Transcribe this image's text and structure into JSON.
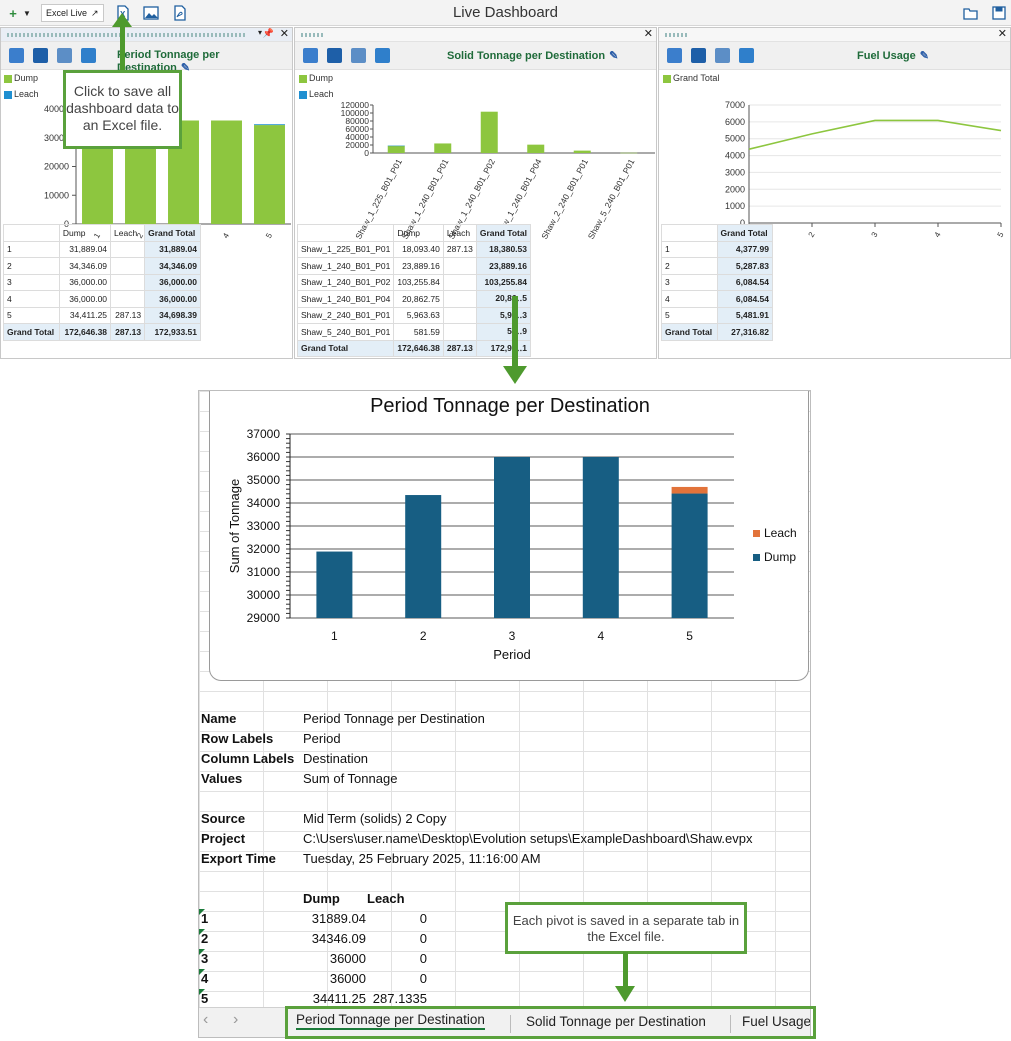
{
  "app": {
    "title": "Live Dashboard",
    "excel_live_label": "Excel Live",
    "add_icon": "plus-icon",
    "icons": [
      "excel-export-icon",
      "image-export-icon",
      "pdf-export-icon",
      "folder-open-icon",
      "save-icon"
    ]
  },
  "callouts": {
    "excel": "Click to save all dashboard data to an Excel file.",
    "tabs": "Each pivot is saved in a separate tab in the Excel file."
  },
  "panel1": {
    "title": "Period Tonnage per Destination",
    "legend": [
      "Dump",
      "Leach"
    ],
    "y_ticks": [
      "40000",
      "30000",
      "20000",
      "10000",
      "0"
    ],
    "x_ticks": [
      "1",
      "2",
      "3",
      "4",
      "5"
    ],
    "table": {
      "headers": [
        "",
        "Dump",
        "Leach",
        "Grand Total"
      ],
      "rows": [
        [
          "1",
          "31,889.04",
          "",
          "31,889.04"
        ],
        [
          "2",
          "34,346.09",
          "",
          "34,346.09"
        ],
        [
          "3",
          "36,000.00",
          "",
          "36,000.00"
        ],
        [
          "4",
          "36,000.00",
          "",
          "36,000.00"
        ],
        [
          "5",
          "34,411.25",
          "287.13",
          "34,698.39"
        ],
        [
          "Grand Total",
          "172,646.38",
          "287.13",
          "172,933.51"
        ]
      ]
    }
  },
  "panel2": {
    "title": "Solid Tonnage per Destination",
    "legend": [
      "Dump",
      "Leach"
    ],
    "y_ticks": [
      "120000",
      "100000",
      "80000",
      "60000",
      "40000",
      "20000",
      "0"
    ],
    "x_ticks": [
      "Shaw_1_225_B01_P01",
      "Shaw_1_240_B01_P01",
      "Shaw_1_240_B01_P02",
      "Shaw_1_240_B01_P04",
      "Shaw_2_240_B01_P01",
      "Shaw_5_240_B01_P01"
    ],
    "table": {
      "headers": [
        "",
        "Dump",
        "Leach",
        "Grand Total"
      ],
      "rows": [
        [
          "Shaw_1_225_B01_P01",
          "18,093.40",
          "287.13",
          "18,380.53"
        ],
        [
          "Shaw_1_240_B01_P01",
          "23,889.16",
          "",
          "23,889.16"
        ],
        [
          "Shaw_1_240_B01_P02",
          "103,255.84",
          "",
          "103,255.84"
        ],
        [
          "Shaw_1_240_B01_P04",
          "20,862.75",
          "",
          "20,86‥5"
        ],
        [
          "Shaw_2_240_B01_P01",
          "5,963.63",
          "",
          "5,96‥3"
        ],
        [
          "Shaw_5_240_B01_P01",
          "581.59",
          "",
          "58‥9"
        ],
        [
          "Grand Total",
          "172,646.38",
          "287.13",
          "172,93‥1"
        ]
      ]
    }
  },
  "panel3": {
    "title": "Fuel Usage",
    "legend": [
      "Grand Total"
    ],
    "y_ticks": [
      "7000",
      "6000",
      "5000",
      "4000",
      "3000",
      "2000",
      "1000",
      "0"
    ],
    "x_ticks": [
      "1",
      "2",
      "3",
      "4",
      "5"
    ],
    "table": {
      "headers": [
        "",
        "Grand Total"
      ],
      "rows": [
        [
          "1",
          "4,377.99"
        ],
        [
          "2",
          "5,287.83"
        ],
        [
          "3",
          "6,084.54"
        ],
        [
          "4",
          "6,084.54"
        ],
        [
          "5",
          "5,481.91"
        ],
        [
          "Grand Total",
          "27,316.82"
        ]
      ]
    }
  },
  "chart_data": [
    {
      "type": "bar",
      "title": "Period Tonnage per Destination",
      "categories": [
        "1",
        "2",
        "3",
        "4",
        "5"
      ],
      "series": [
        {
          "name": "Dump",
          "values": [
            31889.04,
            34346.09,
            36000,
            36000,
            34411.25
          ]
        },
        {
          "name": "Leach",
          "values": [
            0,
            0,
            0,
            0,
            287.13
          ]
        }
      ],
      "ylim": [
        0,
        40000
      ],
      "colors": {
        "Dump": "#8dc63f",
        "Leach": "#1f8fd1"
      }
    },
    {
      "type": "bar",
      "title": "Solid Tonnage per Destination",
      "categories": [
        "Shaw_1_225_B01_P01",
        "Shaw_1_240_B01_P01",
        "Shaw_1_240_B01_P02",
        "Shaw_1_240_B01_P04",
        "Shaw_2_240_B01_P01",
        "Shaw_5_240_B01_P01"
      ],
      "series": [
        {
          "name": "Dump",
          "values": [
            18093.4,
            23889.16,
            103255.84,
            20862.75,
            5963.63,
            581.59
          ]
        },
        {
          "name": "Leach",
          "values": [
            287.13,
            0,
            0,
            0,
            0,
            0
          ]
        }
      ],
      "ylim": [
        0,
        120000
      ],
      "colors": {
        "Dump": "#8dc63f",
        "Leach": "#1f8fd1"
      }
    },
    {
      "type": "line",
      "title": "Fuel Usage",
      "categories": [
        "1",
        "2",
        "3",
        "4",
        "5"
      ],
      "series": [
        {
          "name": "Grand Total",
          "values": [
            4377.99,
            5287.83,
            6084.54,
            6084.54,
            5481.91
          ]
        }
      ],
      "ylim": [
        0,
        7000
      ],
      "colors": {
        "Grand Total": "#8dc63f"
      }
    },
    {
      "type": "bar",
      "title": "Period Tonnage per Destination",
      "xlabel": "Period",
      "ylabel": "Sum of Tonnage",
      "categories": [
        "1",
        "2",
        "3",
        "4",
        "5"
      ],
      "series": [
        {
          "name": "Dump",
          "values": [
            31889.04,
            34346.09,
            36000,
            36000,
            34411.25
          ]
        },
        {
          "name": "Leach",
          "values": [
            0,
            0,
            0,
            0,
            287.1335
          ]
        }
      ],
      "ylim": [
        29000,
        37000
      ],
      "y_ticks": [
        "37000",
        "36000",
        "35000",
        "34000",
        "33000",
        "32000",
        "31000",
        "30000",
        "29000"
      ],
      "legend": [
        "Leach",
        "Dump"
      ],
      "legend_position": "right",
      "grid": true,
      "colors": {
        "Dump": "#175e83",
        "Leach": "#e2733a"
      }
    }
  ],
  "excel": {
    "info": [
      {
        "k": "Name",
        "v": "Period Tonnage per Destination"
      },
      {
        "k": "Row Labels",
        "v": "Period"
      },
      {
        "k": "Column Labels",
        "v": "Destination"
      },
      {
        "k": "Values",
        "v": "Sum of Tonnage"
      },
      {
        "k": "",
        "v": ""
      },
      {
        "k": "Source",
        "v": "Mid Term (solids) 2 Copy"
      },
      {
        "k": "Project",
        "v": "C:\\Users\\user.name\\Desktop\\Evolution setups\\ExampleDashboard\\Shaw.evpx"
      },
      {
        "k": "Export Time",
        "v": "Tuesday, 25 February 2025, 11:16:00 AM"
      }
    ],
    "data_headers": [
      "",
      "Dump",
      "Leach"
    ],
    "data_rows": [
      [
        "1",
        "31889.04",
        "0"
      ],
      [
        "2",
        "34346.09",
        "0"
      ],
      [
        "3",
        "36000",
        "0"
      ],
      [
        "4",
        "36000",
        "0"
      ],
      [
        "5",
        "34411.25",
        "287.1335"
      ]
    ],
    "tabs": [
      "Period Tonnage per Destination",
      "Solid Tonnage per Destination",
      "Fuel Usage"
    ],
    "nav": [
      "‹",
      "›"
    ]
  }
}
